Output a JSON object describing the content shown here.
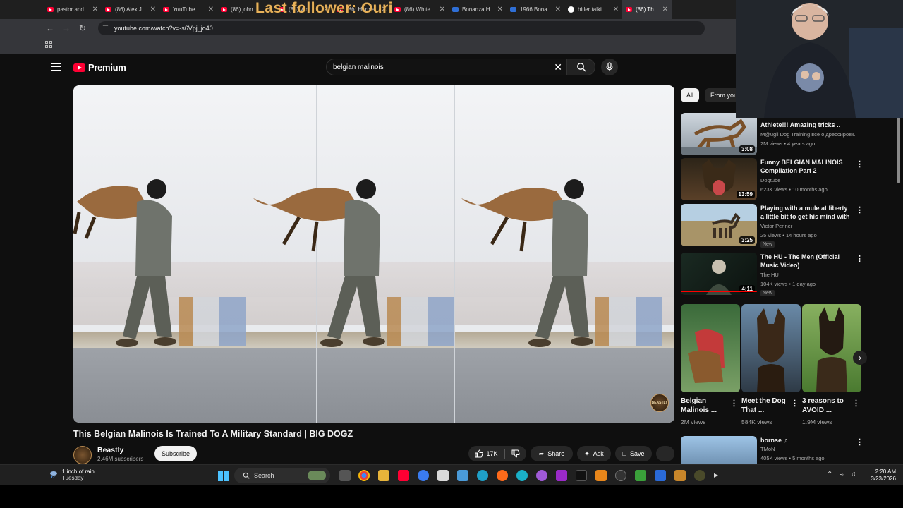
{
  "browser": {
    "tabs": [
      {
        "label": "pastor and",
        "icon": "youtube"
      },
      {
        "label": "(86) Alex J",
        "icon": "youtube"
      },
      {
        "label": "YouTube",
        "icon": "youtube"
      },
      {
        "label": "(86) john",
        "icon": "youtube"
      },
      {
        "label": "(86) Wm",
        "icon": "youtube"
      },
      {
        "label": "(86) Herma",
        "icon": "youtube"
      },
      {
        "label": "(86) White",
        "icon": "youtube"
      },
      {
        "label": "Bonanza H",
        "icon": "bookmark"
      },
      {
        "label": "1966 Bona",
        "icon": "bookmark"
      },
      {
        "label": "hitler talki",
        "icon": "google"
      },
      {
        "label": "(86) Th",
        "icon": "youtube"
      }
    ],
    "url": "youtube.com/watch?v=-s6Vpj_jo40"
  },
  "stream_overlay": {
    "text": "Last follower: Ouri"
  },
  "youtube": {
    "logo_text": "Premium",
    "search_query": "belgian malinois",
    "video": {
      "title": "This Belgian Malinois Is Trained To A Military Standard | BIG DOGZ",
      "watermark": "BEASTLY",
      "channel": "Beastly",
      "subscribers": "2.46M subscribers",
      "subscribe_label": "Subscribe",
      "likes": "17K",
      "share_label": "Share",
      "ask_label": "Ask",
      "save_label": "Save"
    },
    "chips": [
      "All",
      "From your"
    ],
    "recommendations": [
      {
        "title": "Athlete!!! Amazing tricks ..",
        "channel": "M@ugli Dog Training все о дрессировк..",
        "meta": "2M views • 4 years ago",
        "duration": "3:08",
        "is_new": false
      },
      {
        "title": "Funny BELGIAN MALINOIS Compilation Part 2",
        "channel": "Dogtube",
        "meta": "623K views • 10 months ago",
        "duration": "13:59",
        "is_new": false
      },
      {
        "title": "Playing with a mule at liberty a little bit to get his mind with m...",
        "channel": "Victor Penner",
        "meta": "25 views • 14 hours ago",
        "duration": "3:25",
        "is_new": true,
        "new_label": "New"
      },
      {
        "title": "The HU - The Men (Official Music Video)",
        "channel": "The HU",
        "meta": "104K views • 1 day ago",
        "duration": "4:11",
        "is_new": true,
        "new_label": "New"
      }
    ],
    "shorts": [
      {
        "title": "Belgian Malinois ...",
        "views": "2M views"
      },
      {
        "title": "Meet the Dog That ...",
        "views": "584K views"
      },
      {
        "title": "3 reasons to AVOID ...",
        "views": "1.9M views"
      }
    ],
    "last_rec": {
      "title": "hornse ♫",
      "channel": "TMoN",
      "meta": "405K views • 5 months ago"
    }
  },
  "taskbar": {
    "weather_line1": "1 inch of rain",
    "weather_line2": "Tuesday",
    "search_label": "Search",
    "time": "2:20 AM",
    "date": "3/23/2026"
  }
}
